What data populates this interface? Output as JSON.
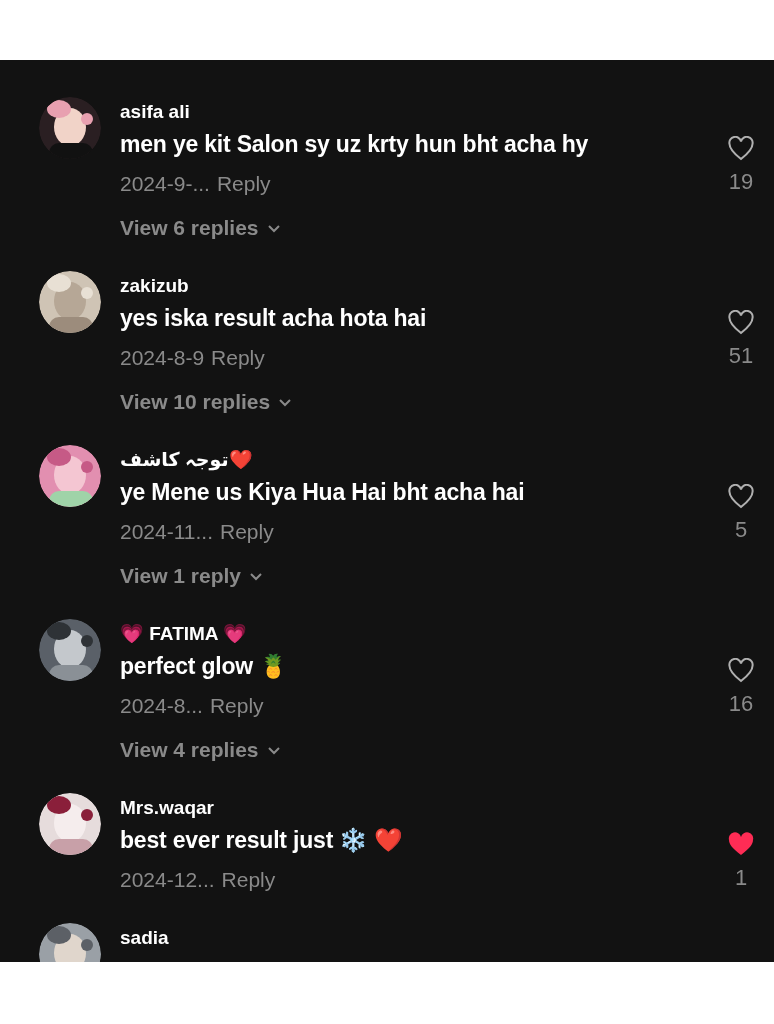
{
  "comments": [
    {
      "username": "asifa ali",
      "text": "men ye kit Salon sy uz krty hun bht acha hy",
      "date": "2024-9-...",
      "reply": "Reply",
      "likes": "19",
      "liked": false,
      "view_replies": "View 6 replies"
    },
    {
      "username": "zakizub",
      "text": "yes iska result acha hota hai",
      "date": "2024-8-9",
      "reply": "Reply",
      "likes": "51",
      "liked": false,
      "view_replies": "View 10 replies"
    },
    {
      "username": "توجہ کاشف❤️",
      "text": "ye Mene us Kiya Hua Hai bht acha hai",
      "date": "2024-11...",
      "reply": "Reply",
      "likes": "5",
      "liked": false,
      "view_replies": "View 1 reply"
    },
    {
      "username": "💗 FATIMA 💗",
      "text": "perfect glow 🍍",
      "date": "2024-8...",
      "reply": "Reply",
      "likes": "16",
      "liked": false,
      "view_replies": "View 4 replies"
    },
    {
      "username": "Mrs.waqar",
      "text": "best ever result just ❄️ ❤️",
      "date": "2024-12...",
      "reply": "Reply",
      "likes": "1",
      "liked": true
    },
    {
      "username": "sadia"
    }
  ]
}
